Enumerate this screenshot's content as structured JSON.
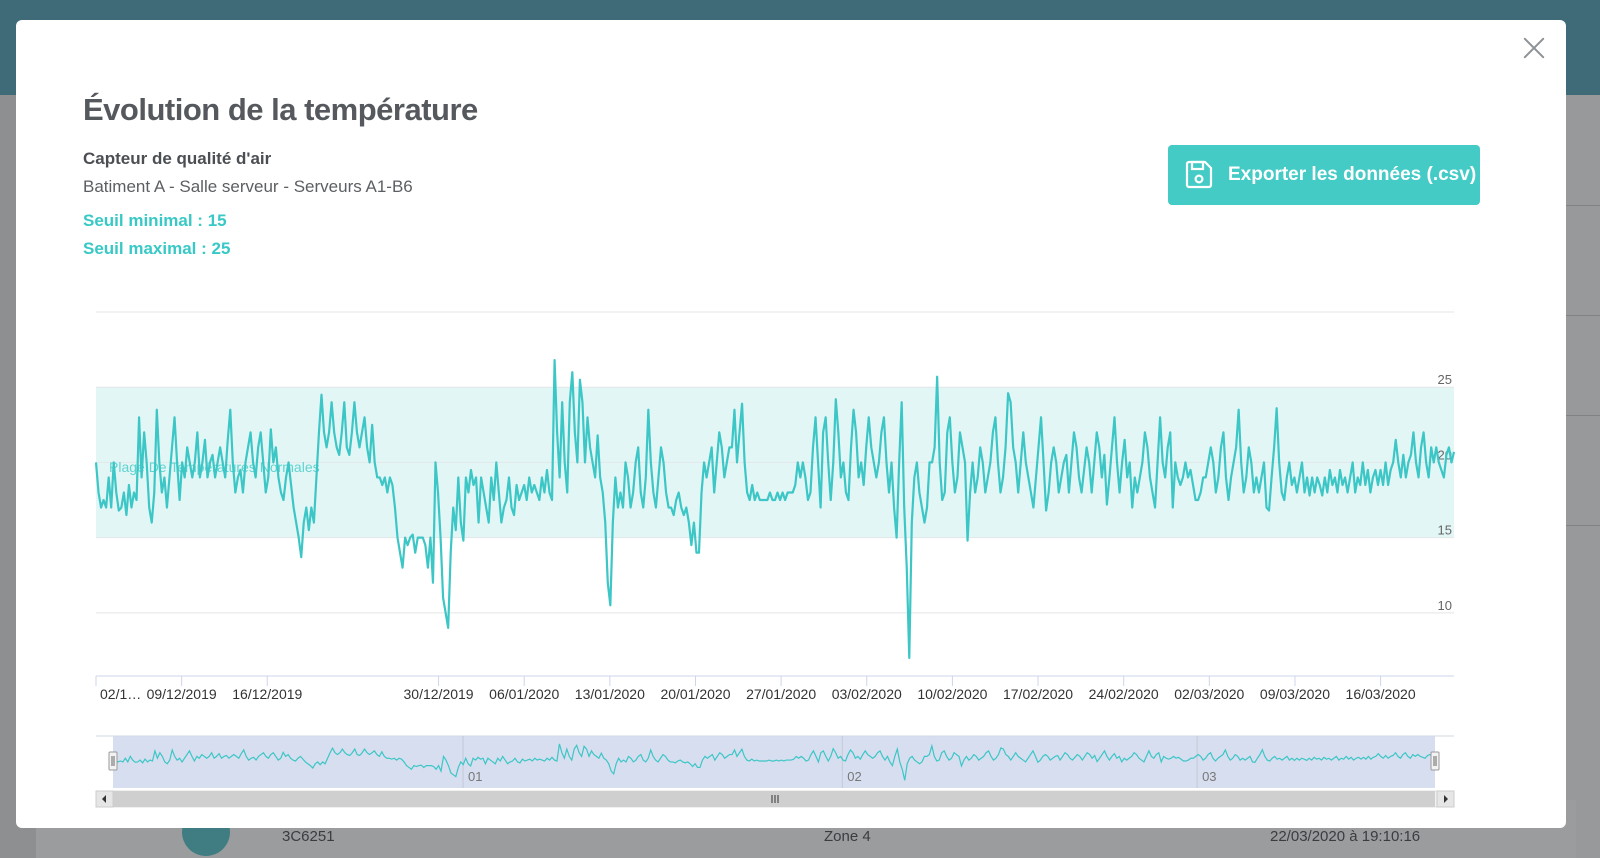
{
  "modal": {
    "title": "Évolution de la température",
    "sensor_name": "Capteur de qualité d'air",
    "location": "Batiment A - Salle serveur - Serveurs A1-B6",
    "min_threshold": "Seuil minimal : 15",
    "max_threshold": "Seuil maximal : 25",
    "export_label": "Exporter les données (.csv)"
  },
  "background": {
    "code": "3C6251",
    "zone": "Zone 4",
    "date": "22/03/2020 à 19:10:16"
  },
  "colors": {
    "series": "#3cc6c6",
    "band": "#e3f6f6",
    "accent": "#45cbc6",
    "navigator": "#d0d8ec"
  },
  "chart_data": {
    "type": "line",
    "band": {
      "label": "Plage De Températures Normales",
      "from": 15,
      "to": 25
    },
    "yticks": [
      10,
      15,
      20,
      25
    ],
    "ylim": [
      5.8,
      30
    ],
    "y_axis_side": "right",
    "grid": true,
    "xlabels": [
      "02/1…",
      "09/12/2019",
      "16/12/2019",
      "30/12/2019",
      "06/01/2020",
      "13/01/2020",
      "20/01/2020",
      "27/01/2020",
      "03/02/2020",
      "10/02/2020",
      "17/02/2020",
      "24/02/2020",
      "02/03/2020",
      "09/03/2020",
      "16/03/2020"
    ],
    "navigator_labels": [
      "01",
      "02",
      "03"
    ],
    "x_start": "02/12/2019",
    "x_end": "22/03/2020",
    "values": [
      20,
      18,
      17,
      17.5,
      17,
      19,
      17,
      20,
      18,
      16.8,
      17,
      18,
      16.5,
      18.5,
      17,
      18,
      17.5,
      23,
      19,
      22,
      20,
      17,
      16,
      18,
      23.5,
      20,
      18,
      19,
      17,
      19,
      21,
      23,
      20,
      17.5,
      20,
      19,
      21,
      20,
      19,
      20,
      22,
      19,
      20,
      21.5,
      19,
      20,
      20.5,
      19,
      20,
      21,
      20,
      19,
      21.5,
      23.5,
      20,
      18,
      19,
      19.5,
      18,
      20,
      21,
      22,
      20,
      19,
      21,
      22,
      20,
      18,
      19,
      22.2,
      20,
      21,
      19,
      18,
      17.5,
      19,
      20,
      18.5,
      17,
      16,
      15,
      13.7,
      16,
      17,
      15.5,
      17,
      16,
      19,
      22,
      24.5,
      22,
      21,
      22,
      24,
      22,
      21,
      20.5,
      22,
      24,
      21,
      20.5,
      22,
      24,
      22,
      21,
      22,
      23,
      21,
      20,
      22.5,
      20,
      19,
      19,
      18.5,
      19,
      18,
      19,
      18.5,
      17,
      15,
      14,
      13,
      15,
      14.5,
      15,
      15.2,
      14,
      15,
      15,
      15,
      14.5,
      13,
      15,
      12,
      20,
      18,
      15,
      11,
      10,
      9,
      14,
      17,
      15.5,
      19,
      16,
      14.8,
      19,
      18,
      19.5,
      18.5,
      19,
      16,
      19,
      18,
      17,
      16,
      19,
      17.5,
      20,
      18,
      16,
      17,
      17.5,
      19,
      17,
      16.5,
      18.5,
      17.5,
      18,
      18.5,
      17.5,
      19,
      18,
      18.5,
      18,
      17.5,
      19,
      18,
      19.5,
      18,
      17.5,
      26.8,
      22,
      19,
      24,
      20,
      18,
      24,
      26,
      22,
      20,
      25.5,
      24,
      20,
      23,
      21,
      20,
      19,
      21.8,
      19,
      18,
      16,
      12,
      10.5,
      16,
      19,
      17,
      18,
      17,
      20,
      19,
      17,
      18,
      20,
      21,
      18,
      17,
      19,
      23.5,
      20,
      18,
      17,
      19,
      21,
      20,
      18,
      17,
      17,
      16.5,
      17.5,
      18,
      17,
      16.5,
      17,
      16,
      14.5,
      16,
      14,
      14,
      18,
      20,
      19,
      20,
      21,
      18,
      20,
      22,
      21,
      19,
      20,
      21,
      21,
      23.5,
      20,
      22,
      23.9,
      20,
      18,
      17.5,
      18.5,
      17.5,
      18,
      17.5,
      17.5,
      17.5,
      17.5,
      18,
      17.5,
      17.5,
      18,
      17.5,
      18,
      17.5,
      18,
      18,
      18,
      18.5,
      20,
      19,
      20,
      19,
      17.5,
      18,
      21,
      23,
      20,
      17,
      22,
      23,
      20,
      17.5,
      20,
      24.2,
      22,
      19,
      20,
      18,
      17.5,
      21,
      23.5,
      22,
      19,
      20,
      18.5,
      21,
      23,
      21,
      20,
      19,
      20,
      22,
      23,
      20,
      18,
      20,
      17,
      15,
      20,
      24,
      17,
      13,
      7,
      16,
      19,
      20,
      18,
      17,
      16,
      17,
      20,
      20,
      21,
      25.7,
      20,
      17.5,
      18,
      22,
      23,
      20,
      18,
      19,
      22,
      21,
      20,
      14.8,
      18,
      20,
      18,
      19,
      21,
      20,
      18,
      19,
      20,
      22,
      23,
      20,
      18,
      19,
      21,
      24.6,
      24,
      21,
      20,
      18,
      20,
      22,
      20,
      19,
      18,
      17,
      19,
      21,
      23,
      20,
      16.8,
      18,
      20,
      21,
      20,
      18,
      19,
      20,
      20.5,
      18,
      20,
      22,
      21,
      19,
      18,
      19.5,
      21,
      20,
      18,
      20,
      22,
      21,
      19,
      20.5,
      17.2,
      19,
      21,
      23,
      20,
      18,
      20,
      21.5,
      19,
      20,
      17,
      19,
      18,
      19,
      20,
      22,
      21,
      19,
      18,
      17,
      20,
      23,
      20,
      19,
      21,
      22,
      17,
      20,
      19,
      18.5,
      19,
      20,
      19,
      19.5,
      18.5,
      17.5,
      17.5,
      18,
      19,
      19,
      20,
      21,
      20,
      18,
      19,
      21,
      22,
      19,
      17.5,
      19,
      20,
      21,
      23.5,
      20,
      18,
      19,
      21,
      20,
      18,
      19,
      18,
      19,
      20,
      17,
      16.8,
      19,
      21,
      23.6,
      20,
      18,
      17.5,
      19,
      20,
      18.5,
      19,
      18,
      19,
      20,
      18,
      19,
      17.8,
      19,
      18,
      19,
      18.5,
      17.8,
      19,
      18,
      19.5,
      18.5,
      19,
      18,
      19.5,
      18.5,
      19,
      18,
      19,
      20,
      18,
      19,
      18.5,
      20,
      18.5,
      19.5,
      18,
      19,
      19.5,
      18.5,
      19.5,
      18.5,
      20,
      18.5,
      19.5,
      20,
      21.5,
      20,
      19,
      20.5,
      19,
      20,
      20.5,
      22,
      20,
      19,
      21,
      22,
      20,
      19,
      21,
      20,
      21,
      20,
      19.5,
      19,
      20.5,
      21,
      20,
      20.7
    ]
  }
}
